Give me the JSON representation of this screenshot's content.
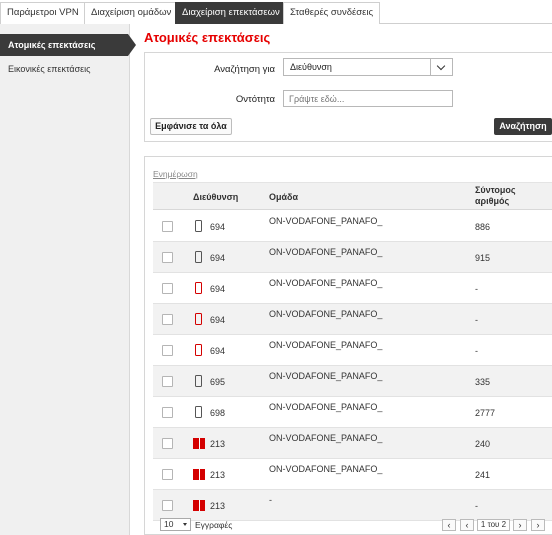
{
  "top_tabs": [
    {
      "label": "Παράμετροι VPN"
    },
    {
      "label": "Διαχείριση ομάδων"
    },
    {
      "label": "Διαχείριση επεκτάσεων"
    },
    {
      "label": "Σταθερές συνδέσεις"
    }
  ],
  "sidebar": {
    "items": [
      {
        "label": "Ατομικές επεκτάσεις"
      },
      {
        "label": "Εικονικές επεκτάσεις"
      }
    ]
  },
  "page_title": "Ατομικές επεκτάσεις",
  "search": {
    "search_for_label": "Αναζήτηση για",
    "search_for_value": "Διεύθυνση",
    "entity_label": "Οντότητα",
    "entity_placeholder": "Γράψτε εδώ...",
    "show_all_label": "Εμφάνισε τα όλα",
    "search_button_label": "Αναζήτηση"
  },
  "results": {
    "refresh_label": "Ενημέρωση",
    "columns": [
      "Διεύθυνση",
      "Ομάδα",
      "Σύντομος αριθμός"
    ],
    "rows": [
      {
        "icon": "mobile-phone-icon",
        "icon_color": "#555555",
        "number": "694",
        "group": "ON-VODAFONE_PANAFO_",
        "short": "886"
      },
      {
        "icon": "mobile-phone-icon",
        "icon_color": "#555555",
        "number": "694",
        "group": "ON-VODAFONE_PANAFO_",
        "short": "915"
      },
      {
        "icon": "mobile-phone-icon",
        "icon_color": "#d40000",
        "number": "694",
        "group": "ON-VODAFONE_PANAFO_",
        "short": "-"
      },
      {
        "icon": "mobile-phone-icon",
        "icon_color": "#d40000",
        "number": "694",
        "group": "ON-VODAFONE_PANAFO_",
        "short": "-"
      },
      {
        "icon": "mobile-phone-icon",
        "icon_color": "#d40000",
        "number": "694",
        "group": "ON-VODAFONE_PANAFO_",
        "short": "-"
      },
      {
        "icon": "mobile-phone-icon",
        "icon_color": "#555555",
        "number": "695",
        "group": "ON-VODAFONE_PANAFO_",
        "short": "335"
      },
      {
        "icon": "mobile-phone-icon",
        "icon_color": "#555555",
        "number": "698",
        "group": "ON-VODAFONE_PANAFO_",
        "short": "2777"
      },
      {
        "icon": "landline-book-icon",
        "icon_color": "#d40000",
        "number": "213",
        "group": "ON-VODAFONE_PANAFO_",
        "short": "240"
      },
      {
        "icon": "landline-book-icon",
        "icon_color": "#d40000",
        "number": "213",
        "group": "ON-VODAFONE_PANAFO_",
        "short": "241"
      },
      {
        "icon": "landline-book-icon",
        "icon_color": "#d40000",
        "number": "213",
        "group": "-",
        "short": "-"
      }
    ]
  },
  "pager": {
    "page_size": "10",
    "records_label": "Εγγραφές",
    "prev": "‹",
    "first": "‹",
    "page_info": "1 του 2",
    "next": "›",
    "last": "›"
  },
  "colors": {
    "accent_red": "#e60000",
    "dark": "#3a3a3a"
  }
}
